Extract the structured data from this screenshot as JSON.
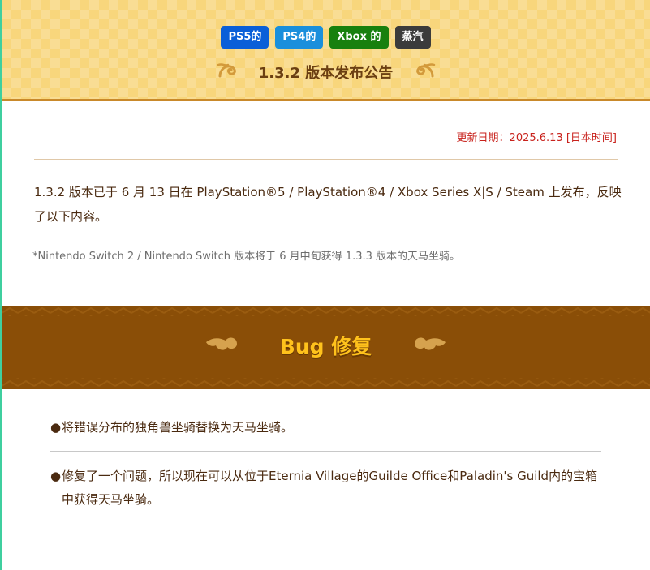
{
  "platform_tags": [
    {
      "label": "PS5的",
      "color": "#0a5fd8"
    },
    {
      "label": "PS4的",
      "color": "#1a8fdc"
    },
    {
      "label": "Xbox 的",
      "color": "#18800e"
    },
    {
      "label": "蒸汽",
      "color": "#3b3b3b"
    }
  ],
  "header": {
    "title": "1.3.2 版本发布公告",
    "ornament_left_icon": "swirl-ornament-icon",
    "ornament_right_icon": "swirl-ornament-icon"
  },
  "meta": {
    "updated": "更新日期：2025.6.13 [日本时间]"
  },
  "intro": {
    "text": "1.3.2 版本已于 6 月 13 日在 PlayStation®5 / PlayStation®4 / Xbox Series X|S / Steam 上发布，反映了以下内容。",
    "note": "*Nintendo Switch 2 / Nintendo Switch 版本将于 6 月中旬获得 1.3.3 版本的天马坐骑。"
  },
  "section": {
    "title": "Bug 修复",
    "color": "#ffc21c",
    "band_color": "#8a4e07",
    "ornament_icon": "cloud-ornament-icon"
  },
  "fixes": [
    {
      "bullet": "●",
      "text": "将错误分布的独角兽坐骑替换为天马坐骑。"
    },
    {
      "bullet": "●",
      "text": "修复了一个问题，所以现在可以从位于Eternia Village的Guilde Office和Paladin's Guild内的宝箱中获得天马坐骑。"
    }
  ],
  "colors": {
    "header_bg": "#f8d67c",
    "date_red": "#c8221c",
    "body_text": "#4a2a10"
  }
}
